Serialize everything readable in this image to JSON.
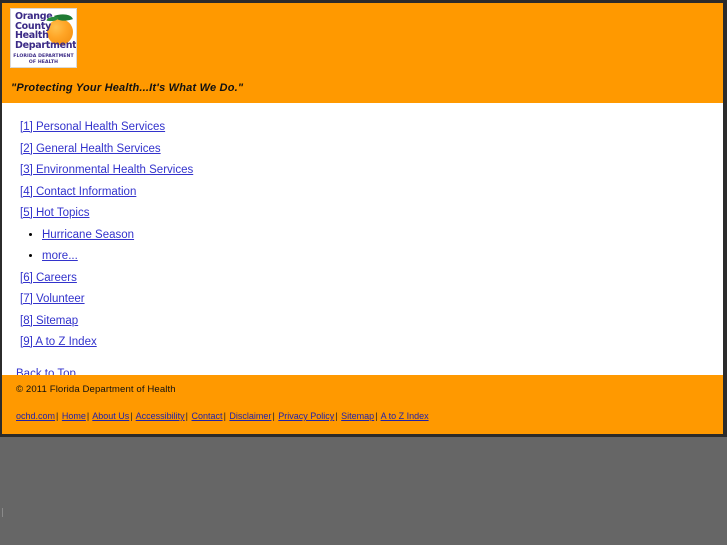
{
  "header": {
    "logo": {
      "line1": "Orange",
      "line2": "County",
      "line3": "Health",
      "line4": "Department",
      "sub1": "FLORIDA DEPARTMENT",
      "sub2": "OF HEALTH",
      "alt": "Orange County Health Department - Florida Department of Health"
    },
    "tagline": "\"Protecting Your Health...It's What We Do.\"",
    "background_color": "#ff9900"
  },
  "nav": {
    "items": [
      {
        "label": "[1] Personal Health Services"
      },
      {
        "label": "[2] General Health Services"
      },
      {
        "label": "[3] Environmental Health Services"
      },
      {
        "label": "[4] Contact Information"
      },
      {
        "label": "[5] Hot Topics",
        "children": [
          {
            "label": "Hurricane Season"
          },
          {
            "label": "more..."
          }
        ]
      },
      {
        "label": "[6] Careers"
      },
      {
        "label": "[7] Volunteer"
      },
      {
        "label": "[8] Sitemap"
      },
      {
        "label": "[9] A to Z Index"
      }
    ],
    "back_to_top": "Back to Top",
    "link_color": "#3333cc"
  },
  "footer": {
    "copyright": "© 2011 Florida Department of Health",
    "links": [
      {
        "label": "ochd.com"
      },
      {
        "label": "Home"
      },
      {
        "label": "About Us"
      },
      {
        "label": "Accessibility"
      },
      {
        "label": "Contact"
      },
      {
        "label": "Disclaimer"
      },
      {
        "label": "Privacy Policy"
      },
      {
        "label": "Sitemap"
      },
      {
        "label": "A to Z Index"
      }
    ],
    "separator": "|",
    "background_color": "#ff9900"
  },
  "page": {
    "viewport_background": "#666666",
    "content_background": "#ffffff"
  }
}
